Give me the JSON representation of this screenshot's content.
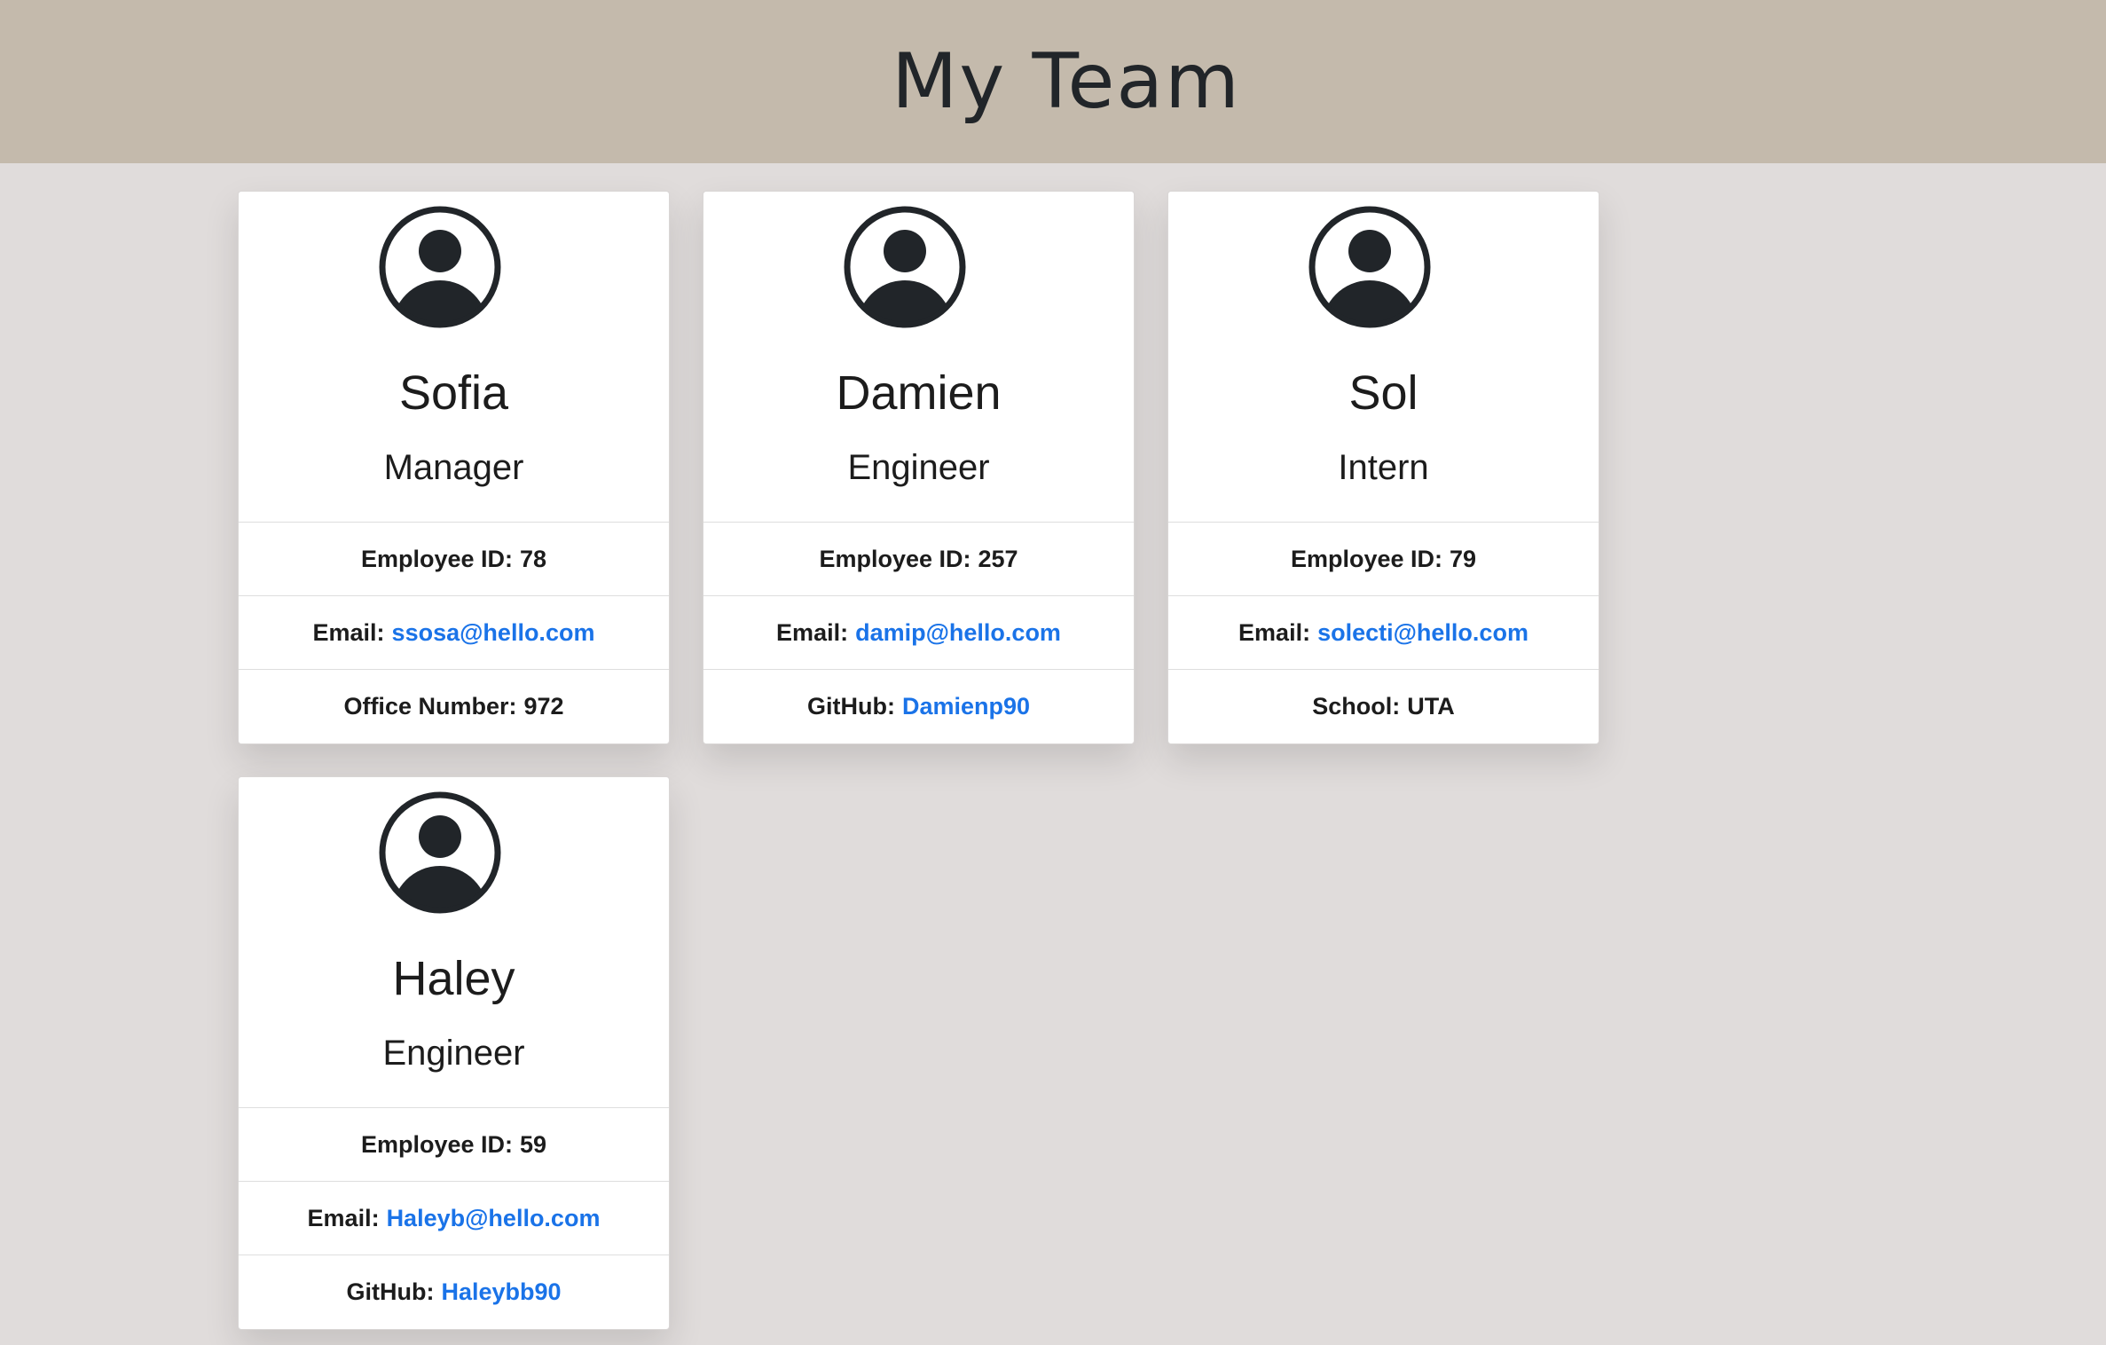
{
  "header": {
    "title": "My Team"
  },
  "employees": [
    {
      "name": "Sofia",
      "role": "Manager",
      "id_label": "Employee ID:",
      "id": "78",
      "email_label": "Email:",
      "email": "ssosa@hello.com",
      "extra_label": "Office Number:",
      "extra_value": "972",
      "extra_is_link": false
    },
    {
      "name": "Damien",
      "role": "Engineer",
      "id_label": "Employee ID:",
      "id": "257",
      "email_label": "Email:",
      "email": "damip@hello.com",
      "extra_label": "GitHub:",
      "extra_value": "Damienp90",
      "extra_is_link": true
    },
    {
      "name": "Sol",
      "role": "Intern",
      "id_label": "Employee ID:",
      "id": "79",
      "email_label": "Email:",
      "email": "solecti@hello.com",
      "extra_label": "School:",
      "extra_value": "UTA",
      "extra_is_link": false
    },
    {
      "name": "Haley",
      "role": "Engineer",
      "id_label": "Employee ID:",
      "id": "59",
      "email_label": "Email:",
      "email": "Haleyb@hello.com",
      "extra_label": "GitHub:",
      "extra_value": "Haleybb90",
      "extra_is_link": true
    }
  ],
  "icons": {
    "avatar": "user-circle-icon"
  },
  "colors": {
    "header_bg": "#c4baac",
    "page_bg": "#e0dcdb",
    "link": "#1a73e8"
  }
}
